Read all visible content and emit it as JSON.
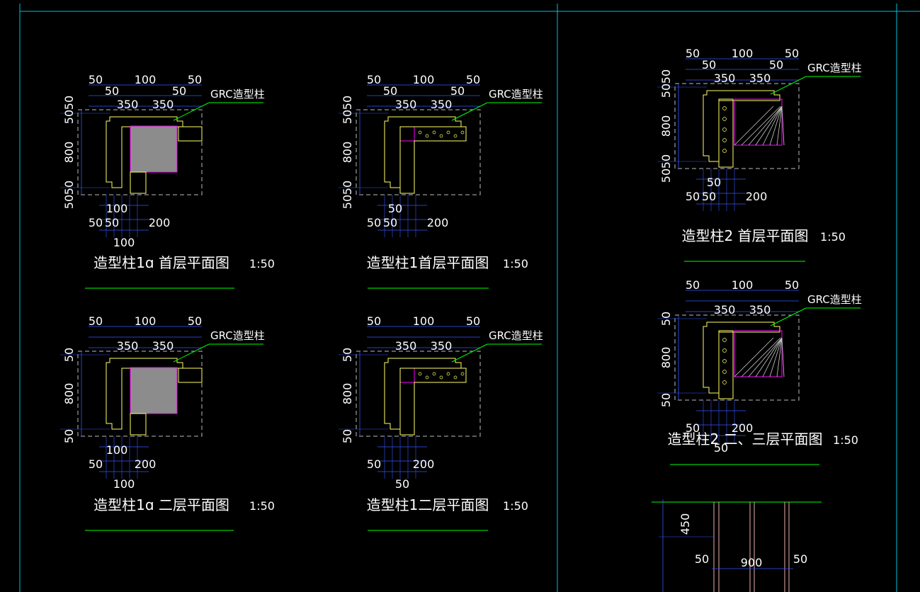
{
  "colors": {
    "background": "#000000",
    "frame": "#00c0d8",
    "dimension": "#3355ff",
    "dim_text": "#ffffff",
    "grc_leader": "#00ff00",
    "title_underline": "#00cc00",
    "grc_outline": "#ffff66",
    "structural_column": "#ff00ff",
    "filled_column": "#8c8c8c",
    "centerline": "#cfcfcf",
    "elevation_line": "#e8b0a8"
  },
  "callout_text": "GRC造型柱",
  "drawings": [
    {
      "id": "col1a-first",
      "title": "造型柱1ɑ  首层平面图",
      "scale": "1:50",
      "variant": "solid",
      "dims": {
        "top1": [
          "50",
          "100",
          "50"
        ],
        "top2": [
          "50",
          "50"
        ],
        "top3": [
          "350",
          "350"
        ],
        "left": [
          "50",
          "50",
          "800",
          "50",
          "50"
        ],
        "bottom1": [
          "100"
        ],
        "bottom2": [
          "50",
          "50",
          "200"
        ],
        "bottom3": [
          "100"
        ]
      }
    },
    {
      "id": "col1-first",
      "title": "造型柱1首层平面图",
      "scale": "1:50",
      "variant": "l-shape",
      "dims": {
        "top1": [
          "50",
          "100",
          "50"
        ],
        "top2": [
          "50",
          "50"
        ],
        "top3": [
          "350",
          "350"
        ],
        "left": [
          "50",
          "50",
          "800",
          "50",
          "50"
        ],
        "bottom1": [
          "50"
        ],
        "bottom2": [
          "50",
          "50",
          "200"
        ],
        "bottom3": []
      }
    },
    {
      "id": "col1a-second",
      "title": "造型柱1ɑ  二层平面图",
      "scale": "1:50",
      "variant": "solid",
      "dims": {
        "top1": [
          "50",
          "100",
          "50"
        ],
        "top2": [],
        "top3": [
          "350",
          "350"
        ],
        "left": [
          "50",
          "800",
          "50"
        ],
        "bottom1": [
          "100"
        ],
        "bottom2": [
          "50",
          "200"
        ],
        "bottom3": [
          "100"
        ]
      }
    },
    {
      "id": "col1-second",
      "title": "造型柱1二层平面图",
      "scale": "1:50",
      "variant": "l-shape",
      "dims": {
        "top1": [
          "50",
          "100",
          "50"
        ],
        "top2": [],
        "top3": [
          "350",
          "350"
        ],
        "left": [
          "50",
          "800",
          "50"
        ],
        "bottom1": [],
        "bottom2": [
          "50",
          "200"
        ],
        "bottom3": [
          "50"
        ]
      }
    },
    {
      "id": "col2-first",
      "title": "造型柱2 首层平面图",
      "scale": "1:50",
      "variant": "hatched",
      "dims": {
        "top1": [
          "50",
          "100",
          "50"
        ],
        "top2": [
          "50",
          "50"
        ],
        "top3": [
          "350",
          "350"
        ],
        "left": [
          "50",
          "50",
          "800",
          "50",
          "50"
        ],
        "bottom1": [
          "50"
        ],
        "bottom2": [
          "50",
          "50",
          "200"
        ],
        "bottom3": []
      }
    },
    {
      "id": "col2-second-third",
      "title": "造型柱2 二、三层平面图",
      "scale": "1:50",
      "variant": "hatched",
      "dims": {
        "top1": [
          "50",
          "100",
          "50"
        ],
        "top2": [],
        "top3": [
          "350",
          "350"
        ],
        "left": [
          "50",
          "800",
          "50"
        ],
        "bottom1": [],
        "bottom2": [
          "50",
          "200"
        ],
        "bottom3": [
          "50"
        ]
      }
    }
  ],
  "elevation": {
    "dims": [
      "450",
      "50",
      "900",
      "50"
    ]
  }
}
